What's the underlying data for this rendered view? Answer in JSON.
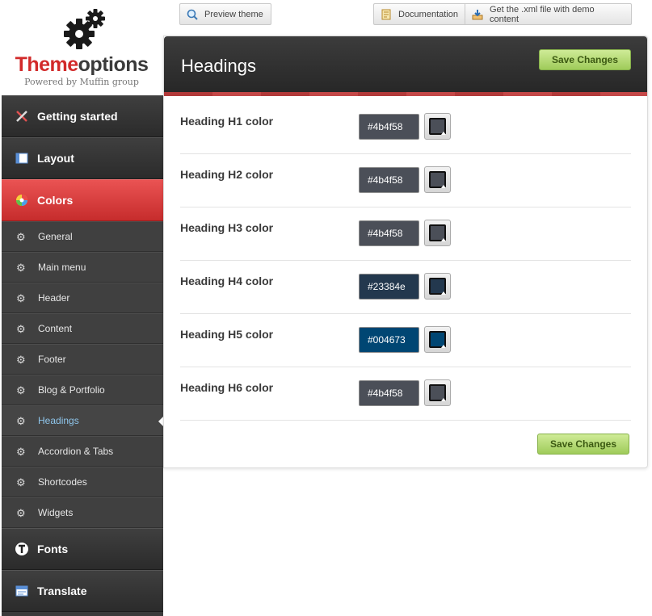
{
  "logo": {
    "brand_part1": "Theme",
    "brand_part2": "options",
    "tagline": "Powered by Muffin group",
    "brand_color": "#d22a2a"
  },
  "topbar": {
    "preview_label": "Preview theme",
    "preview_icon": "magnifier-icon",
    "docs_label": "Documentation",
    "docs_icon": "document-icon",
    "xml_label": "Get the .xml file with demo content",
    "xml_icon": "download-icon"
  },
  "sidebar": {
    "getting_started": "Getting started",
    "layout": "Layout",
    "colors": "Colors",
    "sub_items": [
      {
        "label": "General"
      },
      {
        "label": "Main menu"
      },
      {
        "label": "Header"
      },
      {
        "label": "Content"
      },
      {
        "label": "Footer"
      },
      {
        "label": "Blog & Portfolio"
      },
      {
        "label": "Headings"
      },
      {
        "label": "Accordion & Tabs"
      },
      {
        "label": "Shortcodes"
      },
      {
        "label": "Widgets"
      }
    ],
    "fonts": "Fonts",
    "translate": "Translate",
    "active_sub": "Headings",
    "active_color": "#e24545"
  },
  "panel": {
    "title": "Headings",
    "save_label": "Save Changes",
    "rows": [
      {
        "label": "Heading H1 color",
        "value": "#4b4f58"
      },
      {
        "label": "Heading H2 color",
        "value": "#4b4f58"
      },
      {
        "label": "Heading H3 color",
        "value": "#4b4f58"
      },
      {
        "label": "Heading H4 color",
        "value": "#23384e"
      },
      {
        "label": "Heading H5 color",
        "value": "#004673"
      },
      {
        "label": "Heading H6 color",
        "value": "#4b4f58"
      }
    ]
  }
}
